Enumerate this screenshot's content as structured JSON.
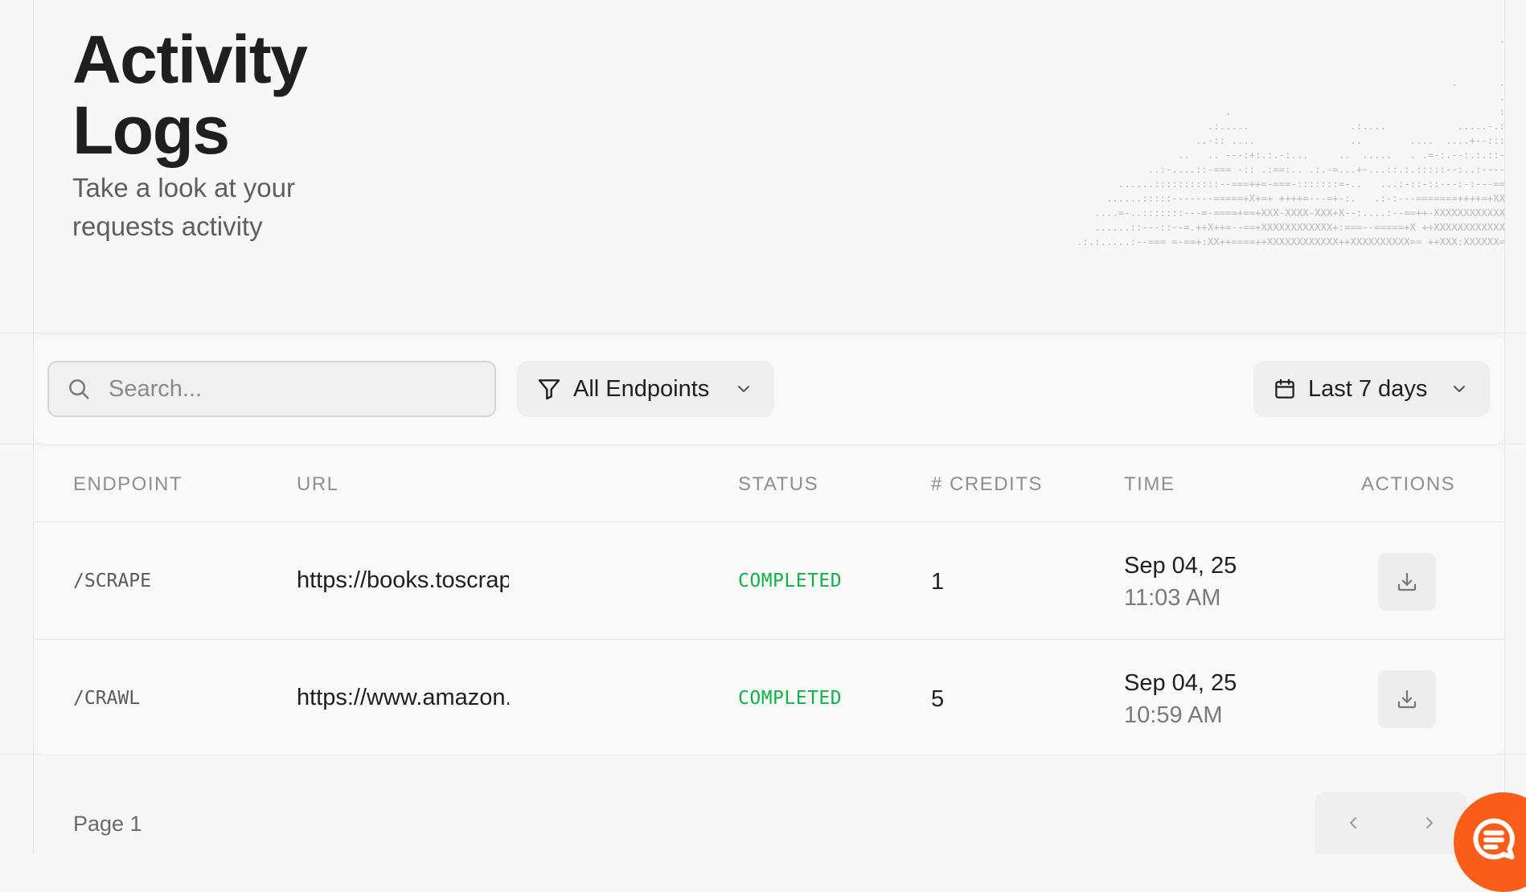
{
  "header": {
    "title": "Activity Logs",
    "subtitle": "Take a look at your requests activity"
  },
  "toolbar": {
    "search_placeholder": "Search...",
    "endpoint_filter": "All Endpoints",
    "date_filter": "Last 7 days"
  },
  "table": {
    "columns": [
      "ENDPOINT",
      "URL",
      "STATUS",
      "# CREDITS",
      "TIME",
      "ACTIONS"
    ],
    "rows": [
      {
        "endpoint": "/SCRAPE",
        "url": "https://books.toscrape.com",
        "status": "COMPLETED",
        "credits": "1",
        "date": "Sep 04, 25",
        "time": "11:03 AM"
      },
      {
        "endpoint": "/CRAWL",
        "url": "https://www.amazon.com",
        "status": "COMPLETED",
        "credits": "5",
        "date": "Sep 04, 25",
        "time": "10:59 AM"
      }
    ]
  },
  "pager": {
    "label": "Page 1"
  },
  "colors": {
    "status_completed": "#10b346",
    "accent": "#fa5d19"
  },
  "icons": [
    "search-icon",
    "filter-icon",
    "chevron-down-icon",
    "calendar-icon",
    "download-icon",
    "chevron-left-icon",
    "chevron-right-icon",
    "chat-icon"
  ]
}
